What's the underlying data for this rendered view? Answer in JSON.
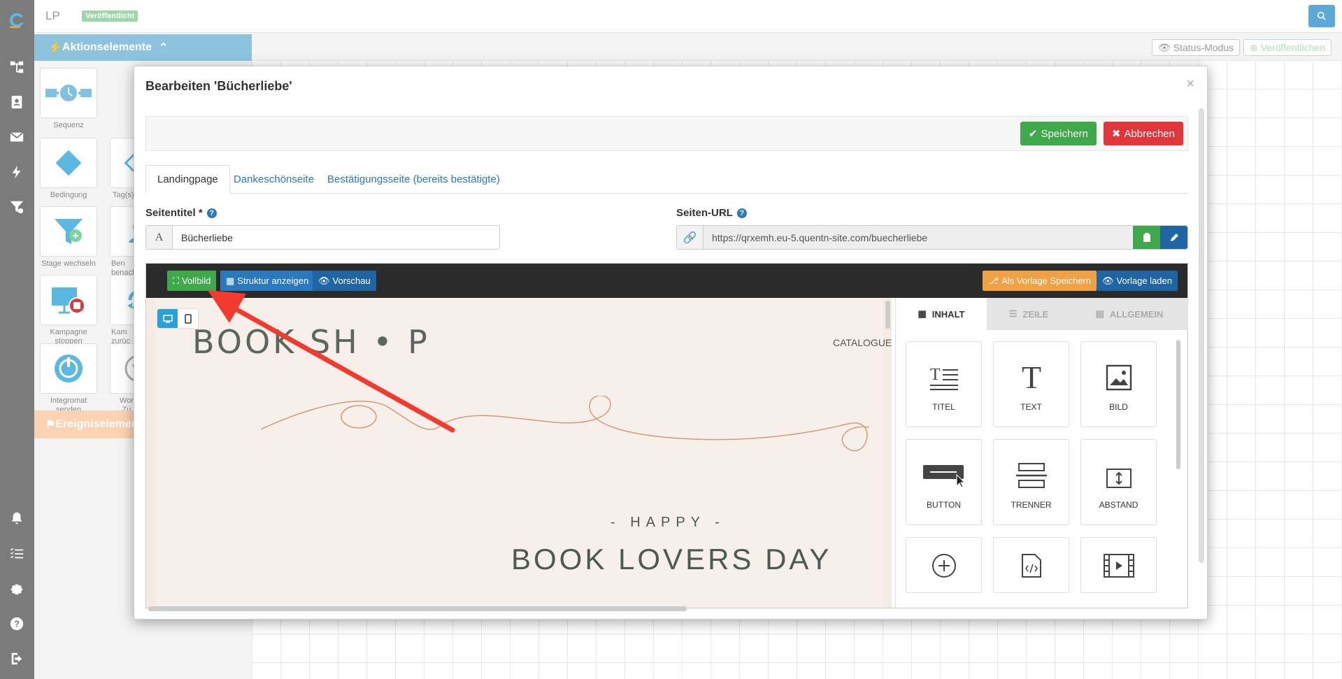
{
  "header": {
    "title": "LP",
    "status_badge": "Veröffentlicht",
    "status_mode": "Status-Modus",
    "publish": "Veröffentlichen"
  },
  "sidebar_panel": {
    "actions_title": "Aktionselemente",
    "events_title": "Ereigniselemente",
    "tiles": [
      {
        "label": "Sequenz",
        "icon": "sequence-icon"
      },
      {
        "label": "Bedingung",
        "icon": "condition-icon"
      },
      {
        "label": "Tag(s)",
        "icon": "tag-icon"
      },
      {
        "label": "Stage wechseln",
        "icon": "funnel-icon"
      },
      {
        "label": "Ben\nbenach",
        "icon": "user-icon"
      },
      {
        "label": "Kampagne\nstoppen",
        "icon": "stop-campaign-icon"
      },
      {
        "label": "Kam\nzurüc",
        "icon": "campaign-back-icon"
      },
      {
        "label": "Integromat\nsenden",
        "icon": "integromat-icon"
      },
      {
        "label": "Wor\nZu",
        "icon": "wordpress-icon"
      }
    ]
  },
  "modal": {
    "title": "Bearbeiten 'Bücherliebe'",
    "save": "Speichern",
    "cancel": "Abbrechen",
    "tabs": [
      "Landingpage",
      "Dankeschönseite",
      "Bestätigungsseite (bereits bestätigte)"
    ],
    "page_title_label": "Seitentitel *",
    "page_title_value": "Bücherliebe",
    "page_url_label": "Seiten-URL",
    "page_url_value": "https://qrxemh.eu-5.quentn-site.com/buecherliebe"
  },
  "editor": {
    "fullscreen": "Vollbild",
    "show_structure": "Struktur anzeigen",
    "preview": "Vorschau",
    "save_template": "Als Vorlage Speichern",
    "load_template": "Vorlage laden",
    "preview_logo": "BOOK SH • P",
    "preview_catalogue": "CATALOGUE",
    "preview_happy": "- HAPPY -",
    "preview_headline": "BOOK LOVERS DAY",
    "side_tabs": [
      "INHALT",
      "ZEILE",
      "ALLGEMEIN"
    ],
    "blocks": [
      "TITEL",
      "TEXT",
      "BILD",
      "BUTTON",
      "TRENNER",
      "ABSTAND"
    ]
  },
  "colors": {
    "accent": "#2a78bd",
    "success": "#3ea84b",
    "danger": "#e0353b",
    "warning": "#f0a143",
    "annotation_arrow": "#f23a2f"
  }
}
